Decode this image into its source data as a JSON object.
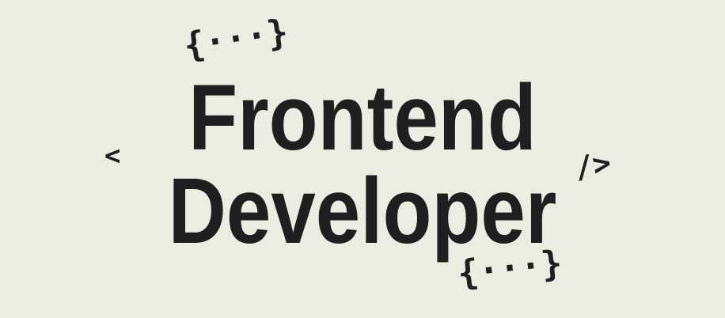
{
  "text": {
    "line1": "Frontend",
    "line2": "Developer",
    "brace_top": "{···}",
    "brace_bottom": "{···}",
    "tag_open": "<",
    "tag_close": "/>"
  },
  "colors": {
    "background": "#EDECE3",
    "foreground": "#1F1F1F"
  }
}
